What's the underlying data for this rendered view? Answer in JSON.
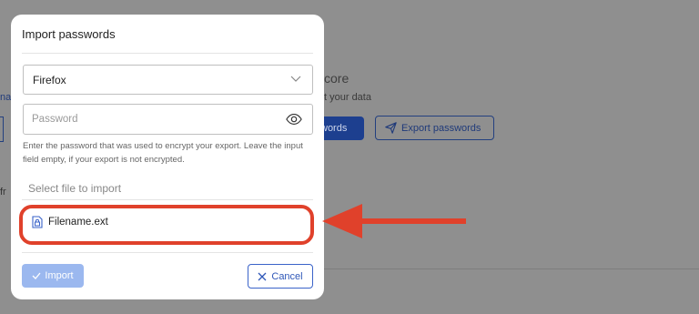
{
  "background": {
    "title_fragment": "core",
    "subtitle_fragment": "t your data",
    "import_button_fragment": "words",
    "export_button": "Export passwords",
    "left_link_fragment": "na",
    "left_text_fragment": "fr"
  },
  "modal": {
    "title": "Import passwords",
    "browser_select": {
      "selected": "Firefox"
    },
    "password": {
      "placeholder": "Password"
    },
    "help_text": "Enter the password that was used to encrypt your export. Leave the input field empty, if your export is not encrypted.",
    "file_section_label": "Select file to import",
    "file_name": "Filename.ext",
    "import_button": "Import",
    "cancel_button": "Cancel"
  },
  "colors": {
    "highlight": "#e0412b",
    "primary": "#3a63c9",
    "primary_disabled": "#9bb8ef"
  },
  "icons": [
    "chevron-down-icon",
    "eye-icon",
    "file-lock-icon",
    "check-icon",
    "close-icon",
    "send-icon",
    "red-arrow"
  ]
}
